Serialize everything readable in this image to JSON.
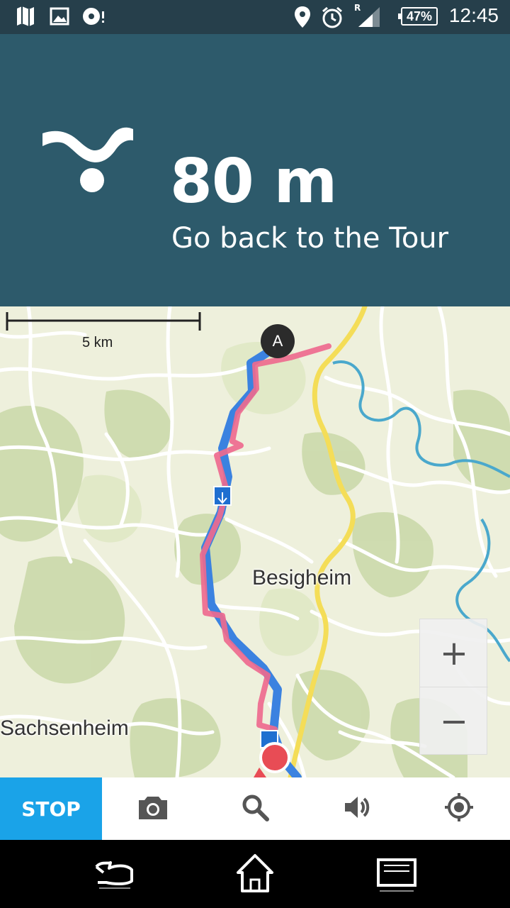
{
  "status_bar": {
    "time": "12:45",
    "battery": "47%",
    "roaming": "R",
    "icons": [
      "map-icon",
      "image-icon",
      "record-icon",
      "location-pin-icon",
      "alarm-icon",
      "signal-icon",
      "battery-icon"
    ]
  },
  "navigation": {
    "distance": "80 m",
    "instruction": "Go back to the Tour",
    "turn_icon": "turn-back-icon"
  },
  "map": {
    "scale_label": "5 km",
    "places": [
      "Besigheim",
      "Sachsenheim"
    ],
    "start_marker_label": "A",
    "zoom_in_label": "+",
    "zoom_out_label": "−",
    "colors": {
      "route": "#ee6a8e",
      "track": "#3b82e0",
      "water": "#3aa5c9",
      "highway": "#f6e04a",
      "marker": "#e84c55"
    }
  },
  "toolbar": {
    "stop_label": "STOP",
    "tools": [
      "camera-icon",
      "search-icon",
      "volume-icon",
      "locate-icon"
    ],
    "stop_color": "#1aa3e8"
  },
  "system_nav": {
    "buttons": [
      "back-icon",
      "home-icon",
      "recents-icon"
    ]
  }
}
